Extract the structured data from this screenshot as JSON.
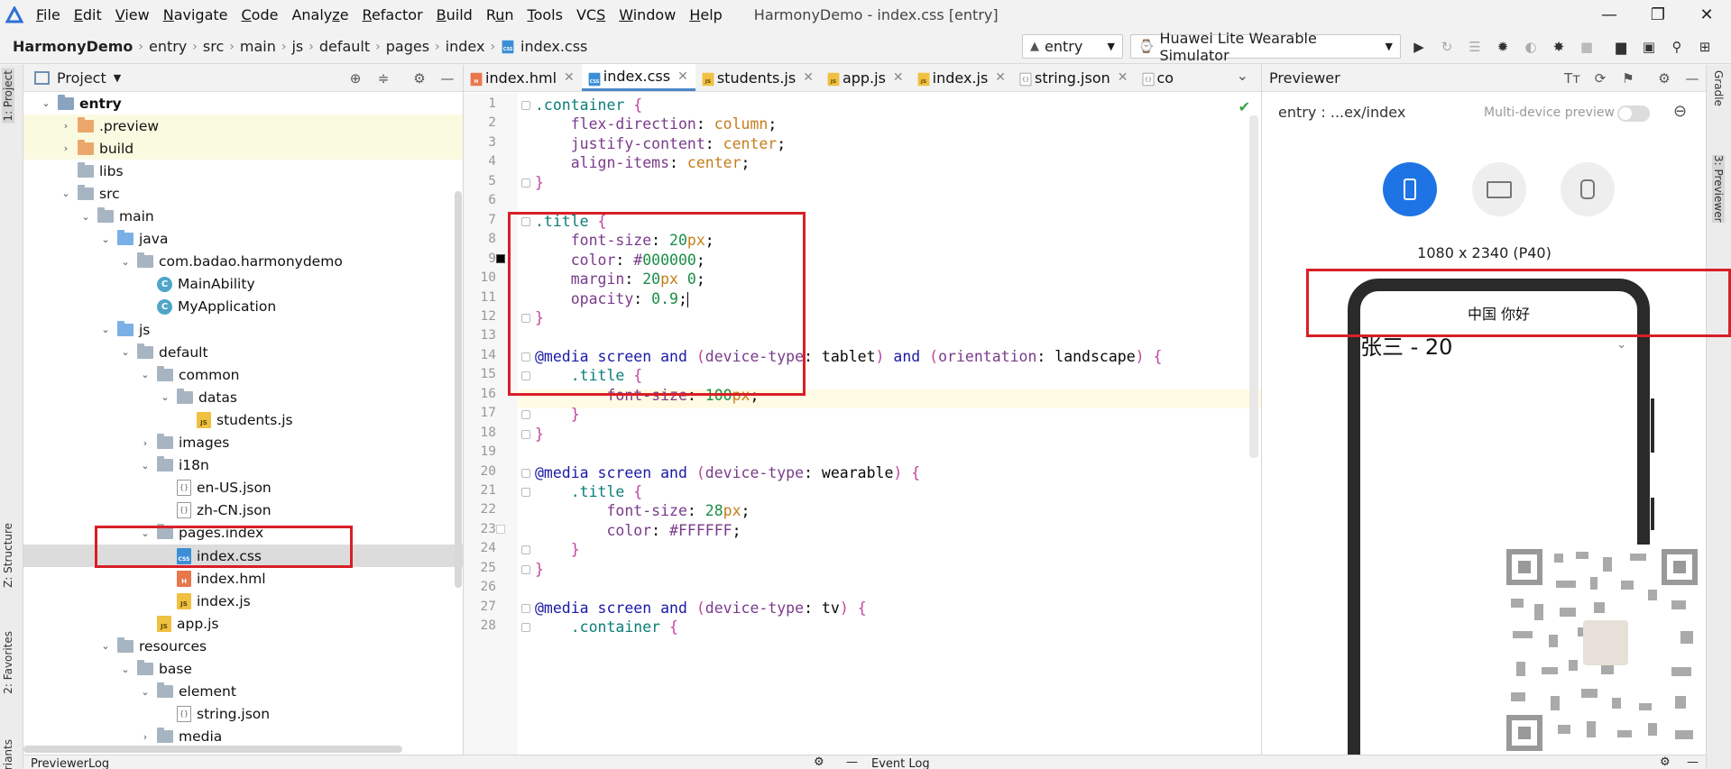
{
  "menubar": {
    "items": [
      {
        "pre": "",
        "u": "F",
        "post": "ile"
      },
      {
        "pre": "",
        "u": "E",
        "post": "dit"
      },
      {
        "pre": "",
        "u": "V",
        "post": "iew"
      },
      {
        "pre": "",
        "u": "N",
        "post": "avigate"
      },
      {
        "pre": "",
        "u": "C",
        "post": "ode"
      },
      {
        "pre": "Analy",
        "u": "z",
        "post": "e"
      },
      {
        "pre": "",
        "u": "R",
        "post": "efactor"
      },
      {
        "pre": "",
        "u": "B",
        "post": "uild"
      },
      {
        "pre": "R",
        "u": "u",
        "post": "n"
      },
      {
        "pre": "",
        "u": "T",
        "post": "ools"
      },
      {
        "pre": "VC",
        "u": "S",
        "post": ""
      },
      {
        "pre": "",
        "u": "W",
        "post": "indow"
      },
      {
        "pre": "",
        "u": "H",
        "post": "elp"
      }
    ],
    "window_title": "HarmonyDemo - index.css [entry]"
  },
  "breadcrumb": [
    "HarmonyDemo",
    "entry",
    "src",
    "main",
    "js",
    "default",
    "pages",
    "index",
    "index.css"
  ],
  "toolbar": {
    "module": "entry",
    "device": "Huawei Lite Wearable Simulator"
  },
  "project": {
    "title": "Project",
    "tree": [
      {
        "label": "entry",
        "arrow": "▾",
        "icon": "module",
        "bold": true,
        "hl": false,
        "sel": false
      },
      {
        "label": ".preview",
        "arrow": "▸",
        "icon": "folder-orange",
        "bold": false,
        "hl": true,
        "sel": false
      },
      {
        "label": "build",
        "arrow": "▸",
        "icon": "folder-orange",
        "bold": false,
        "hl": true,
        "sel": false
      },
      {
        "label": "libs",
        "arrow": "",
        "icon": "folder",
        "bold": false,
        "hl": false,
        "sel": false
      },
      {
        "label": "src",
        "arrow": "▾",
        "icon": "folder",
        "bold": false,
        "hl": false,
        "sel": false
      },
      {
        "label": "main",
        "arrow": "▾",
        "icon": "folder",
        "bold": false,
        "hl": false,
        "sel": false
      },
      {
        "label": "java",
        "arrow": "▾",
        "icon": "folder-blue",
        "bold": false,
        "hl": false,
        "sel": false
      },
      {
        "label": "com.badao.harmonydemo",
        "arrow": "▾",
        "icon": "folder",
        "bold": false,
        "hl": false,
        "sel": false
      },
      {
        "label": "MainAbility",
        "arrow": "",
        "icon": "class",
        "bold": false,
        "hl": false,
        "sel": false
      },
      {
        "label": "MyApplication",
        "arrow": "",
        "icon": "class",
        "bold": false,
        "hl": false,
        "sel": false
      },
      {
        "label": "js",
        "arrow": "▾",
        "icon": "folder-blue",
        "bold": false,
        "hl": false,
        "sel": false
      },
      {
        "label": "default",
        "arrow": "▾",
        "icon": "folder",
        "bold": false,
        "hl": false,
        "sel": false
      },
      {
        "label": "common",
        "arrow": "▾",
        "icon": "folder",
        "bold": false,
        "hl": false,
        "sel": false
      },
      {
        "label": "datas",
        "arrow": "▾",
        "icon": "folder",
        "bold": false,
        "hl": false,
        "sel": false
      },
      {
        "label": "students.js",
        "arrow": "",
        "icon": "js",
        "bold": false,
        "hl": false,
        "sel": false
      },
      {
        "label": "images",
        "arrow": "▸",
        "icon": "folder",
        "bold": false,
        "hl": false,
        "sel": false
      },
      {
        "label": "i18n",
        "arrow": "▾",
        "icon": "folder",
        "bold": false,
        "hl": false,
        "sel": false
      },
      {
        "label": "en-US.json",
        "arrow": "",
        "icon": "json",
        "bold": false,
        "hl": false,
        "sel": false
      },
      {
        "label": "zh-CN.json",
        "arrow": "",
        "icon": "json",
        "bold": false,
        "hl": false,
        "sel": false
      },
      {
        "label": "pages.index",
        "arrow": "▾",
        "icon": "folder",
        "bold": false,
        "hl": false,
        "sel": false
      },
      {
        "label": "index.css",
        "arrow": "",
        "icon": "css",
        "bold": false,
        "hl": false,
        "sel": true
      },
      {
        "label": "index.hml",
        "arrow": "",
        "icon": "html",
        "bold": false,
        "hl": false,
        "sel": false
      },
      {
        "label": "index.js",
        "arrow": "",
        "icon": "js",
        "bold": false,
        "hl": false,
        "sel": false
      },
      {
        "label": "app.js",
        "arrow": "",
        "icon": "js",
        "bold": false,
        "hl": false,
        "sel": false
      },
      {
        "label": "resources",
        "arrow": "▾",
        "icon": "folder",
        "bold": false,
        "hl": false,
        "sel": false
      },
      {
        "label": "base",
        "arrow": "▾",
        "icon": "folder",
        "bold": false,
        "hl": false,
        "sel": false
      },
      {
        "label": "element",
        "arrow": "▾",
        "icon": "folder",
        "bold": false,
        "hl": false,
        "sel": false
      },
      {
        "label": "string.json",
        "arrow": "",
        "icon": "json",
        "bold": false,
        "hl": false,
        "sel": false
      },
      {
        "label": "media",
        "arrow": "▸",
        "icon": "folder",
        "bold": false,
        "hl": false,
        "sel": false
      }
    ]
  },
  "editor": {
    "tabs": [
      {
        "label": "index.hml",
        "icon": "html",
        "active": false
      },
      {
        "label": "index.css",
        "icon": "css",
        "active": true
      },
      {
        "label": "students.js",
        "icon": "js",
        "active": false
      },
      {
        "label": "app.js",
        "icon": "js",
        "active": false
      },
      {
        "label": "index.js",
        "icon": "js",
        "active": false
      },
      {
        "label": "string.json",
        "icon": "json",
        "active": false
      },
      {
        "label": "co",
        "icon": "json",
        "active": false
      }
    ],
    "lines": [
      [
        "1",
        ".container {"
      ],
      [
        "2",
        "    flex-direction: column;"
      ],
      [
        "3",
        "    justify-content: center;"
      ],
      [
        "4",
        "    align-items: center;"
      ],
      [
        "5",
        "}"
      ],
      [
        "6",
        ""
      ],
      [
        "7",
        ".title {"
      ],
      [
        "8",
        "    font-size: 20px;"
      ],
      [
        "9",
        "    color: #000000;"
      ],
      [
        "10",
        "    margin: 20px 0;"
      ],
      [
        "11",
        "    opacity: 0.9;"
      ],
      [
        "12",
        "}"
      ],
      [
        "13",
        ""
      ],
      [
        "14",
        "@media screen and (device-type: tablet) and (orientation: landscape) {"
      ],
      [
        "15",
        "    .title {"
      ],
      [
        "16",
        "        font-size: 100px;"
      ],
      [
        "17",
        "    }"
      ],
      [
        "18",
        "}"
      ],
      [
        "19",
        ""
      ],
      [
        "20",
        "@media screen and (device-type: wearable) {"
      ],
      [
        "21",
        "    .title {"
      ],
      [
        "22",
        "        font-size: 28px;"
      ],
      [
        "23",
        "        color: #FFFFFF;"
      ],
      [
        "24",
        "    }"
      ],
      [
        "25",
        "}"
      ],
      [
        "26",
        ""
      ],
      [
        "27",
        "@media screen and (device-type: tv) {"
      ],
      [
        "28",
        "    .container {"
      ]
    ]
  },
  "previewer": {
    "title": "Previewer",
    "path": "entry : ...ex/index",
    "multi_device_label": "Multi-device preview",
    "resolution": "1080 x 2340 (P40)",
    "screen_title": "中国 你好",
    "picker_value": "张三 - 20"
  },
  "side_tabs": {
    "left": [
      "1: Project",
      "Z: Structure",
      "2: Favorites",
      "riants"
    ],
    "right": [
      "Gradle",
      "3: Previewer"
    ]
  },
  "bottom": {
    "left_title": "PreviewerLog",
    "right_title": "Event Log"
  },
  "colors": {
    "accent": "#1e74e5",
    "highlight_box": "#d81f26",
    "selection": "#dcdcdc"
  }
}
